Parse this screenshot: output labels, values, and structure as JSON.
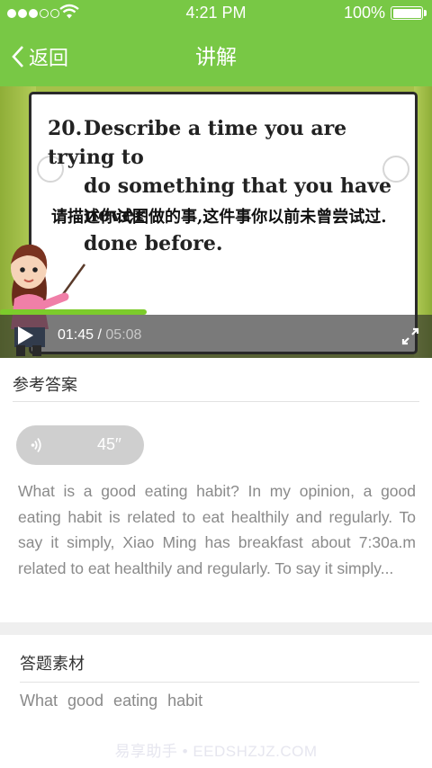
{
  "status": {
    "time": "4:21 PM",
    "battery": "100%"
  },
  "nav": {
    "back_label": "返回",
    "title": "讲解"
  },
  "video": {
    "question_number": "20.",
    "question_lines": [
      "Describe a time you are trying to",
      "do something that you have never",
      "done before."
    ],
    "question_cn": "请描述你试图做的事,这件事你以前未曾尝试过.",
    "current_time": "01:45",
    "separator": " / ",
    "duration": "05:08",
    "progress_percent": 34
  },
  "answer_section": {
    "title": "参考答案",
    "audio_duration": "45′′",
    "text": "What is a good eating habit? In my opinion, a good eating habit is related to eat healthily and regularly. To say it simply, Xiao Ming has breakfast about 7:30a.m related to eat healthily and regularly. To say it simply..."
  },
  "material_section": {
    "title": "答题素材",
    "text": "What good  eating  habit"
  },
  "watermark": "易享助手 • EEDSHZJZ.COM",
  "colors": {
    "accent": "#78c845",
    "progress": "#7ccb2b",
    "text_muted": "#8a8a8a"
  },
  "icons": [
    "signal-dots-icon",
    "wifi-icon",
    "battery-icon",
    "back-chevron-icon",
    "play-icon",
    "fullscreen-icon",
    "speaker-icon"
  ]
}
